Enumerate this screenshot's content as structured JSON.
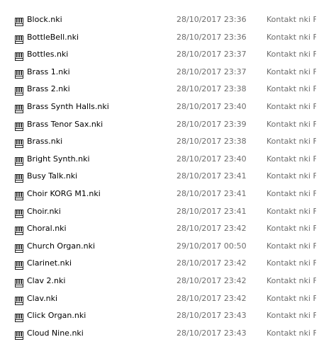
{
  "files": [
    {
      "name": "Block.nki",
      "date": "28/10/2017 23:36",
      "type": "Kontakt nki File",
      "icon": "kontakt-file-icon"
    },
    {
      "name": "BottleBell.nki",
      "date": "28/10/2017 23:36",
      "type": "Kontakt nki File",
      "icon": "kontakt-file-icon"
    },
    {
      "name": "Bottles.nki",
      "date": "28/10/2017 23:37",
      "type": "Kontakt nki File",
      "icon": "kontakt-file-icon"
    },
    {
      "name": "Brass 1.nki",
      "date": "28/10/2017 23:37",
      "type": "Kontakt nki File",
      "icon": "kontakt-file-icon"
    },
    {
      "name": "Brass 2.nki",
      "date": "28/10/2017 23:38",
      "type": "Kontakt nki File",
      "icon": "kontakt-file-icon"
    },
    {
      "name": "Brass Synth Halls.nki",
      "date": "28/10/2017 23:40",
      "type": "Kontakt nki File",
      "icon": "kontakt-file-icon"
    },
    {
      "name": "Brass Tenor Sax.nki",
      "date": "28/10/2017 23:39",
      "type": "Kontakt nki File",
      "icon": "kontakt-file-icon"
    },
    {
      "name": "Brass.nki",
      "date": "28/10/2017 23:38",
      "type": "Kontakt nki File",
      "icon": "kontakt-file-icon"
    },
    {
      "name": "Bright Synth.nki",
      "date": "28/10/2017 23:40",
      "type": "Kontakt nki File",
      "icon": "kontakt-file-icon"
    },
    {
      "name": "Busy Talk.nki",
      "date": "28/10/2017 23:41",
      "type": "Kontakt nki File",
      "icon": "kontakt-file-icon"
    },
    {
      "name": "Choir KORG M1.nki",
      "date": "28/10/2017 23:41",
      "type": "Kontakt nki File",
      "icon": "kontakt-file-icon"
    },
    {
      "name": "Choir.nki",
      "date": "28/10/2017 23:41",
      "type": "Kontakt nki File",
      "icon": "kontakt-file-icon"
    },
    {
      "name": "Choral.nki",
      "date": "28/10/2017 23:42",
      "type": "Kontakt nki File",
      "icon": "kontakt-file-icon"
    },
    {
      "name": "Church Organ.nki",
      "date": "29/10/2017 00:50",
      "type": "Kontakt nki File",
      "icon": "kontakt-file-icon"
    },
    {
      "name": "Clarinet.nki",
      "date": "28/10/2017 23:42",
      "type": "Kontakt nki File",
      "icon": "kontakt-file-icon"
    },
    {
      "name": "Clav 2.nki",
      "date": "28/10/2017 23:42",
      "type": "Kontakt nki File",
      "icon": "kontakt-file-icon"
    },
    {
      "name": "Clav.nki",
      "date": "28/10/2017 23:42",
      "type": "Kontakt nki File",
      "icon": "kontakt-file-icon"
    },
    {
      "name": "Click Organ.nki",
      "date": "28/10/2017 23:43",
      "type": "Kontakt nki File",
      "icon": "kontakt-file-icon"
    },
    {
      "name": "Cloud Nine.nki",
      "date": "28/10/2017 23:43",
      "type": "Kontakt nki File",
      "icon": "kontakt-file-icon"
    }
  ]
}
